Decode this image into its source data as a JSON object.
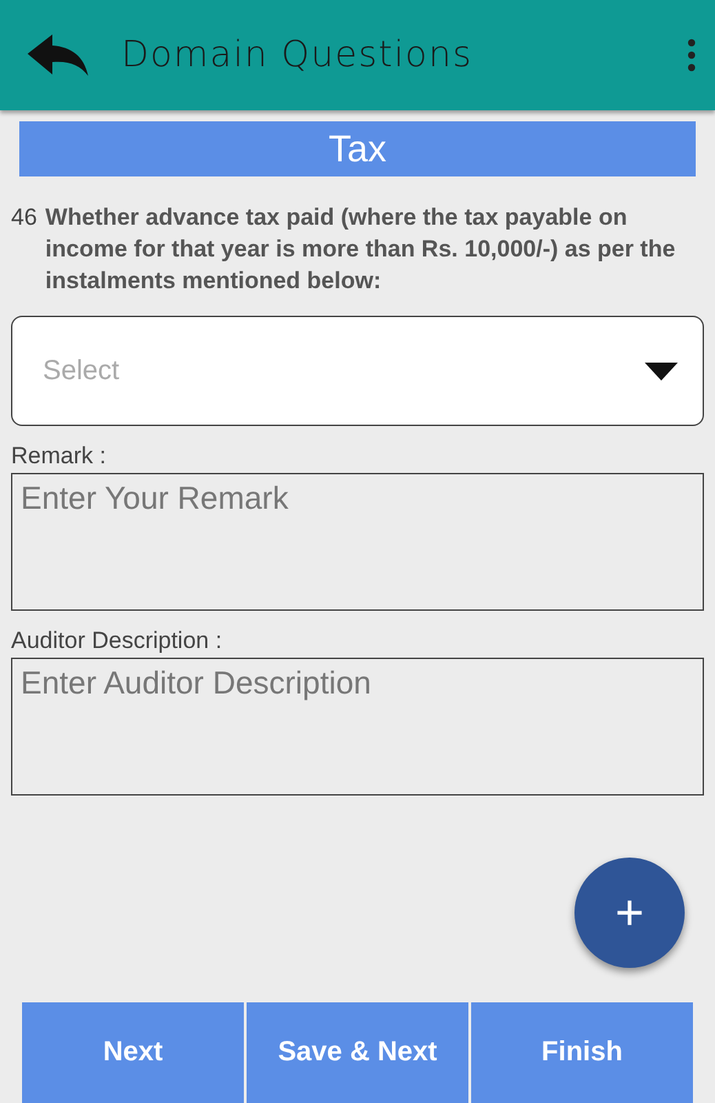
{
  "header": {
    "title": "Domain Questions"
  },
  "section": {
    "title": "Tax"
  },
  "question": {
    "number": "46",
    "text": "Whether advance tax paid (where the tax payable on income for that year is more than Rs. 10,000/-) as per the instalments mentioned below:"
  },
  "answer_select": {
    "placeholder": "Select"
  },
  "remark": {
    "label": "Remark :",
    "placeholder": "Enter Your Remark"
  },
  "auditor_description": {
    "label": "Auditor Description :",
    "placeholder": "Enter Auditor Description"
  },
  "fab": {
    "label": "+"
  },
  "buttons": [
    "Next",
    "Save & Next",
    "Finish"
  ]
}
